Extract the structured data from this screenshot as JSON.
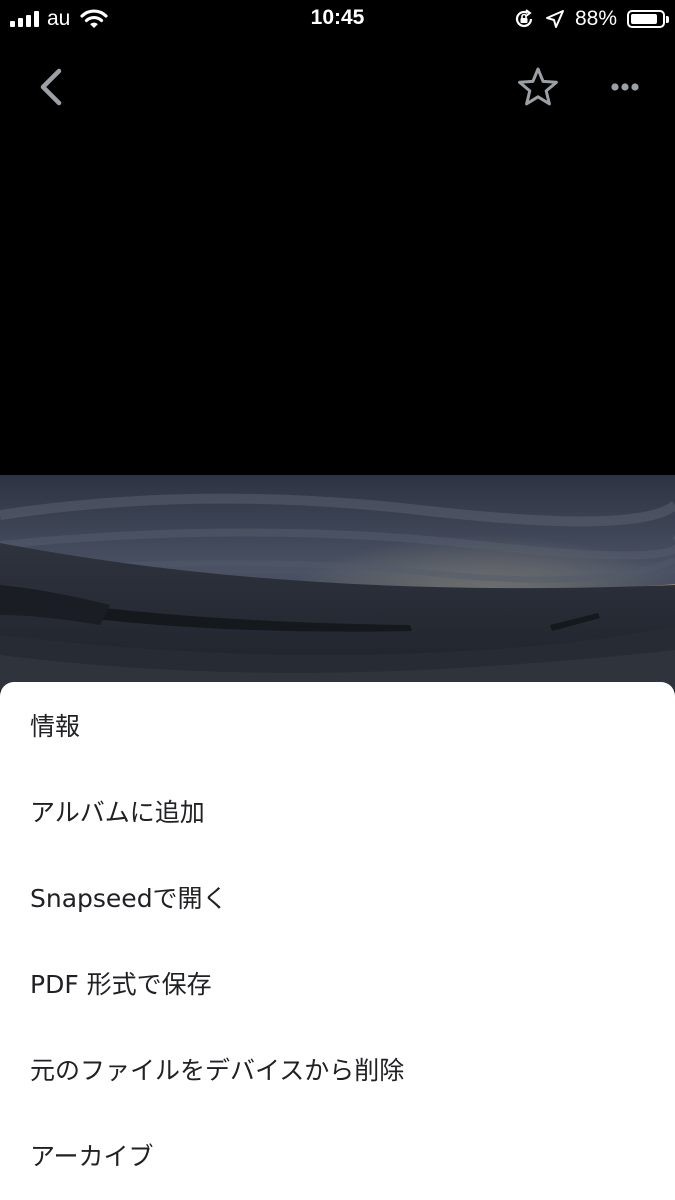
{
  "status_bar": {
    "carrier": "au",
    "time": "10:45",
    "battery_percent": "88%",
    "battery_level": 0.88,
    "icons": [
      "signal-bars-icon",
      "wifi-icon",
      "orientation-lock-icon",
      "location-arrow-icon",
      "battery-icon"
    ]
  },
  "toolbar": {
    "back_icon": "chevron-left-icon",
    "favorite_icon": "star-outline-icon",
    "more_icon": "more-horizontal-icon"
  },
  "photo": {
    "subject": "panoramic seascape at dusk"
  },
  "menu": {
    "items": [
      {
        "label": "情報"
      },
      {
        "label": "アルバムに追加"
      },
      {
        "label": "Snapseedで開く"
      },
      {
        "label": "PDF 形式で保存"
      },
      {
        "label": "元のファイルをデバイスから削除"
      },
      {
        "label": "アーカイブ"
      }
    ]
  },
  "colors": {
    "background": "#000000",
    "sheet": "#ffffff",
    "menu_text": "#202124",
    "icon": "#9aa0a6"
  }
}
